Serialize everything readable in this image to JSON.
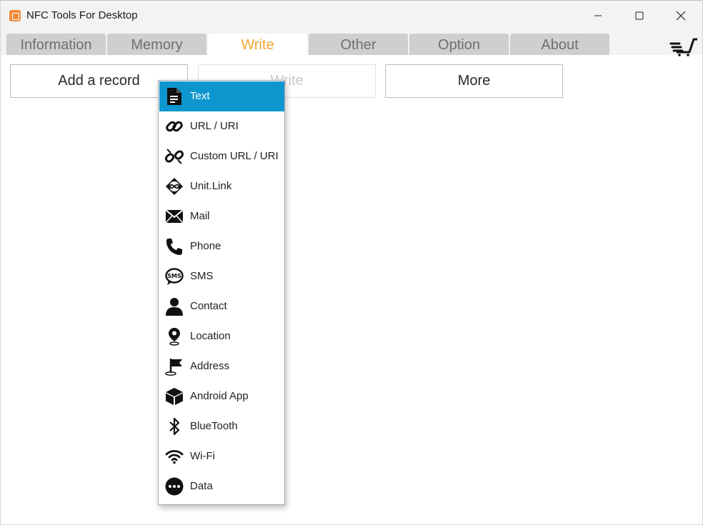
{
  "window": {
    "title": "NFC Tools For Desktop",
    "app_icon": "nfc-app-icon"
  },
  "tabs": [
    {
      "label": "Information",
      "active": false
    },
    {
      "label": "Memory",
      "active": false
    },
    {
      "label": "Write",
      "active": true
    },
    {
      "label": "Other",
      "active": false
    },
    {
      "label": "Option",
      "active": false
    },
    {
      "label": "About",
      "active": false
    }
  ],
  "toolbar": {
    "add_record_label": "Add a record",
    "write_label": "Write",
    "more_label": "More"
  },
  "record_menu": {
    "items": [
      {
        "label": "Text",
        "icon": "document-icon",
        "selected": true
      },
      {
        "label": "URL / URI",
        "icon": "link-icon",
        "selected": false
      },
      {
        "label": "Custom URL / URI",
        "icon": "broken-link-icon",
        "selected": false
      },
      {
        "label": "Unit.Link",
        "icon": "unit-link-icon",
        "selected": false
      },
      {
        "label": "Mail",
        "icon": "envelope-icon",
        "selected": false
      },
      {
        "label": "Phone",
        "icon": "phone-icon",
        "selected": false
      },
      {
        "label": "SMS",
        "icon": "sms-bubble-icon",
        "selected": false
      },
      {
        "label": "Contact",
        "icon": "person-icon",
        "selected": false
      },
      {
        "label": "Location",
        "icon": "map-pin-icon",
        "selected": false
      },
      {
        "label": "Address",
        "icon": "flag-pin-icon",
        "selected": false
      },
      {
        "label": "Android App",
        "icon": "package-box-icon",
        "selected": false
      },
      {
        "label": "BlueTooth",
        "icon": "bluetooth-icon",
        "selected": false
      },
      {
        "label": "Wi-Fi",
        "icon": "wifi-icon",
        "selected": false
      },
      {
        "label": "Data",
        "icon": "more-dots-icon",
        "selected": false
      }
    ]
  },
  "colors": {
    "accent_tab": "#f2a534",
    "menu_selection": "#0e97cf",
    "app_icon": "#f08a3c"
  }
}
